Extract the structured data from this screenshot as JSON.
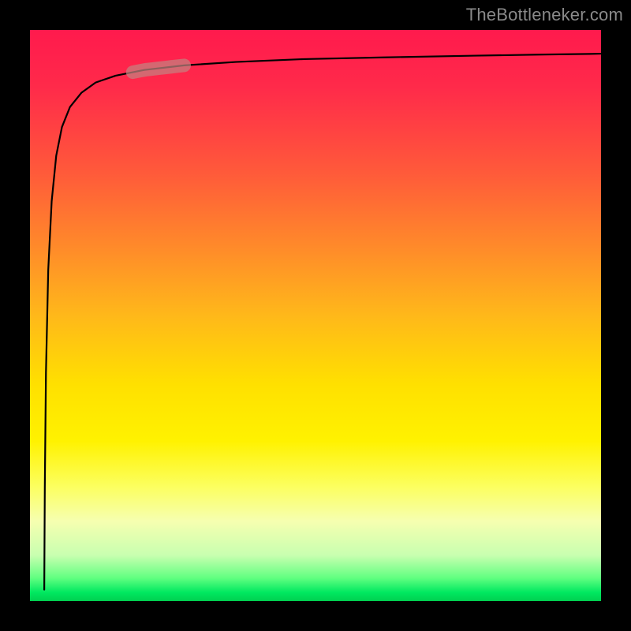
{
  "watermark": "TheBottleneker.com",
  "chart_data": {
    "type": "line",
    "title": "",
    "xlabel": "",
    "ylabel": "",
    "xlim": [
      0,
      100
    ],
    "ylim": [
      0,
      100
    ],
    "background_gradient": {
      "top_color": "#ff1a4d",
      "mid_color": "#fff200",
      "bottom_color": "#00d050"
    },
    "series": [
      {
        "name": "curve",
        "x": [
          2.5,
          2.6,
          2.8,
          3.2,
          3.8,
          4.6,
          5.6,
          7.0,
          9.0,
          11.5,
          15.0,
          20.0,
          27.0,
          36.0,
          48.0,
          62.0,
          78.0,
          90.0,
          98.0,
          100.0
        ],
        "y": [
          2.0,
          20.0,
          40.0,
          58.0,
          70.0,
          78.0,
          83.0,
          86.5,
          89.0,
          90.8,
          92.0,
          93.0,
          93.8,
          94.4,
          94.9,
          95.2,
          95.5,
          95.7,
          95.8,
          95.85
        ]
      }
    ],
    "highlight_segment": {
      "x_start": 18.0,
      "x_end": 27.0,
      "note": "thick translucent marker over curve"
    }
  }
}
